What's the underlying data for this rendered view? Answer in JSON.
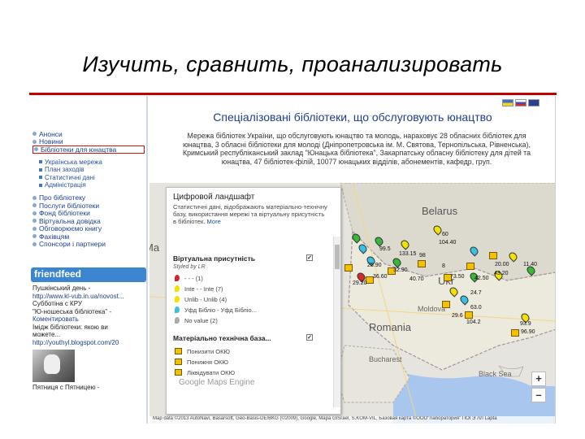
{
  "slide": {
    "title": "Изучить, сравнить, проанализировать"
  },
  "sidebar": {
    "nav_top": [
      "Анонси",
      "Новини",
      "Бібліотеки для юнацтва"
    ],
    "nav_sub": [
      "Українська мережа",
      "План заходів",
      "Статистичні дані",
      "Адміністрація"
    ],
    "nav_bottom": [
      "Про бібліотеку",
      "Послуги бібліотеки",
      "Фонд бібліотеки",
      "Віртуальна довідка",
      "Обговорюємо книгу",
      "Фахівцям",
      "Спонсори і партнери"
    ],
    "friendfeed": "friendfeed",
    "feed": [
      "Пушкінський день -",
      "http://www.kl-vub.in.ua/novost...",
      "Субботіна с КРУ",
      "\"Ю-ношеська бібліотека\" -",
      "Коментировать",
      "Імідж бібліотеки: якою ви",
      "можете...",
      "http://youthyl.blogspot.com/20",
      "Пятниця с Пятницею -"
    ]
  },
  "main": {
    "title": "Спеціалізовані бібліотеки, що обслуговують юнацтво",
    "description": "Мережа бібліотек України, що обслуговують юнацтво та молодь, нараховує 28 обласних бібліотек для юнацтва, 3 обласні бібліотеки для молоді (Дніпропетровська ім. М. Святова, Тернопільська, Рівненська), Кримський республіканський заклад \"Юнацька бібліотека\", Закарпатську обласну бібліотеку для дітей та юнацтва, 47 бібліотек-філій, 10077 юнацьких відділів, абонементів, кафедр, груп."
  },
  "legend": {
    "header": "Цифровой ландшафт",
    "text": "Статистичні дані, відображають матеріально-технічну базу, використання мережі та віртуальну присутність в бібліотек.",
    "more": "More",
    "section1": "Віртуальна присутність",
    "section1_check": "✓",
    "styled_by": "Styled by LR",
    "virtual_rows": [
      "- - - (1)",
      "Inte - - Inte (7)",
      "Unlib - Unlib (4)",
      "Уфд Бібліо - Уфд Бібліо...",
      "No value (2)"
    ],
    "virtual_colors": [
      "#d62828",
      "#f2e200",
      "#f2e200",
      "#36c2e0",
      "#aaaaaa"
    ],
    "section2": "Матеріально технічна база...",
    "section2_check": "✓",
    "base_rows": [
      "Понизити ОКЮ",
      "Понижня ОКЮ",
      "Ліквідувати ОКЮ"
    ]
  },
  "map": {
    "labels": {
      "belarus": "Belarus",
      "ukraine": "Ukr",
      "romania": "Romania",
      "moldova": "Moldova",
      "bucharest": "Bucharest",
      "black_sea": "Black Sea",
      "ma": "Ma"
    },
    "zoom_in": "+",
    "zoom_out": "–",
    "watermark": "Google Maps Engine",
    "attribution": "Map data ©2013 AutoNavi, Basarsoft, Geo-Basis-DE/BKG (©2009), Google, Mapa GISrael, S.KOM-VIL, Базовая карта ©ООО\"Лаборатория\" ПОГЭ ЛЛ Lapta"
  },
  "values": [
    "60",
    "104.40",
    "99.5",
    "133.15",
    "98",
    "20.00",
    "43.20",
    "29.20",
    "36.60",
    "11.40",
    "8",
    "73.50",
    "42.50",
    "32.90",
    "40.70",
    "93.9",
    "96.90",
    "63.0",
    "104.2",
    "24.7",
    "29.6",
    "25.90"
  ],
  "colors": {
    "accent_red": "#c00000",
    "link_blue": "#1a3f8f",
    "title_blue": "#1d3e8a"
  }
}
